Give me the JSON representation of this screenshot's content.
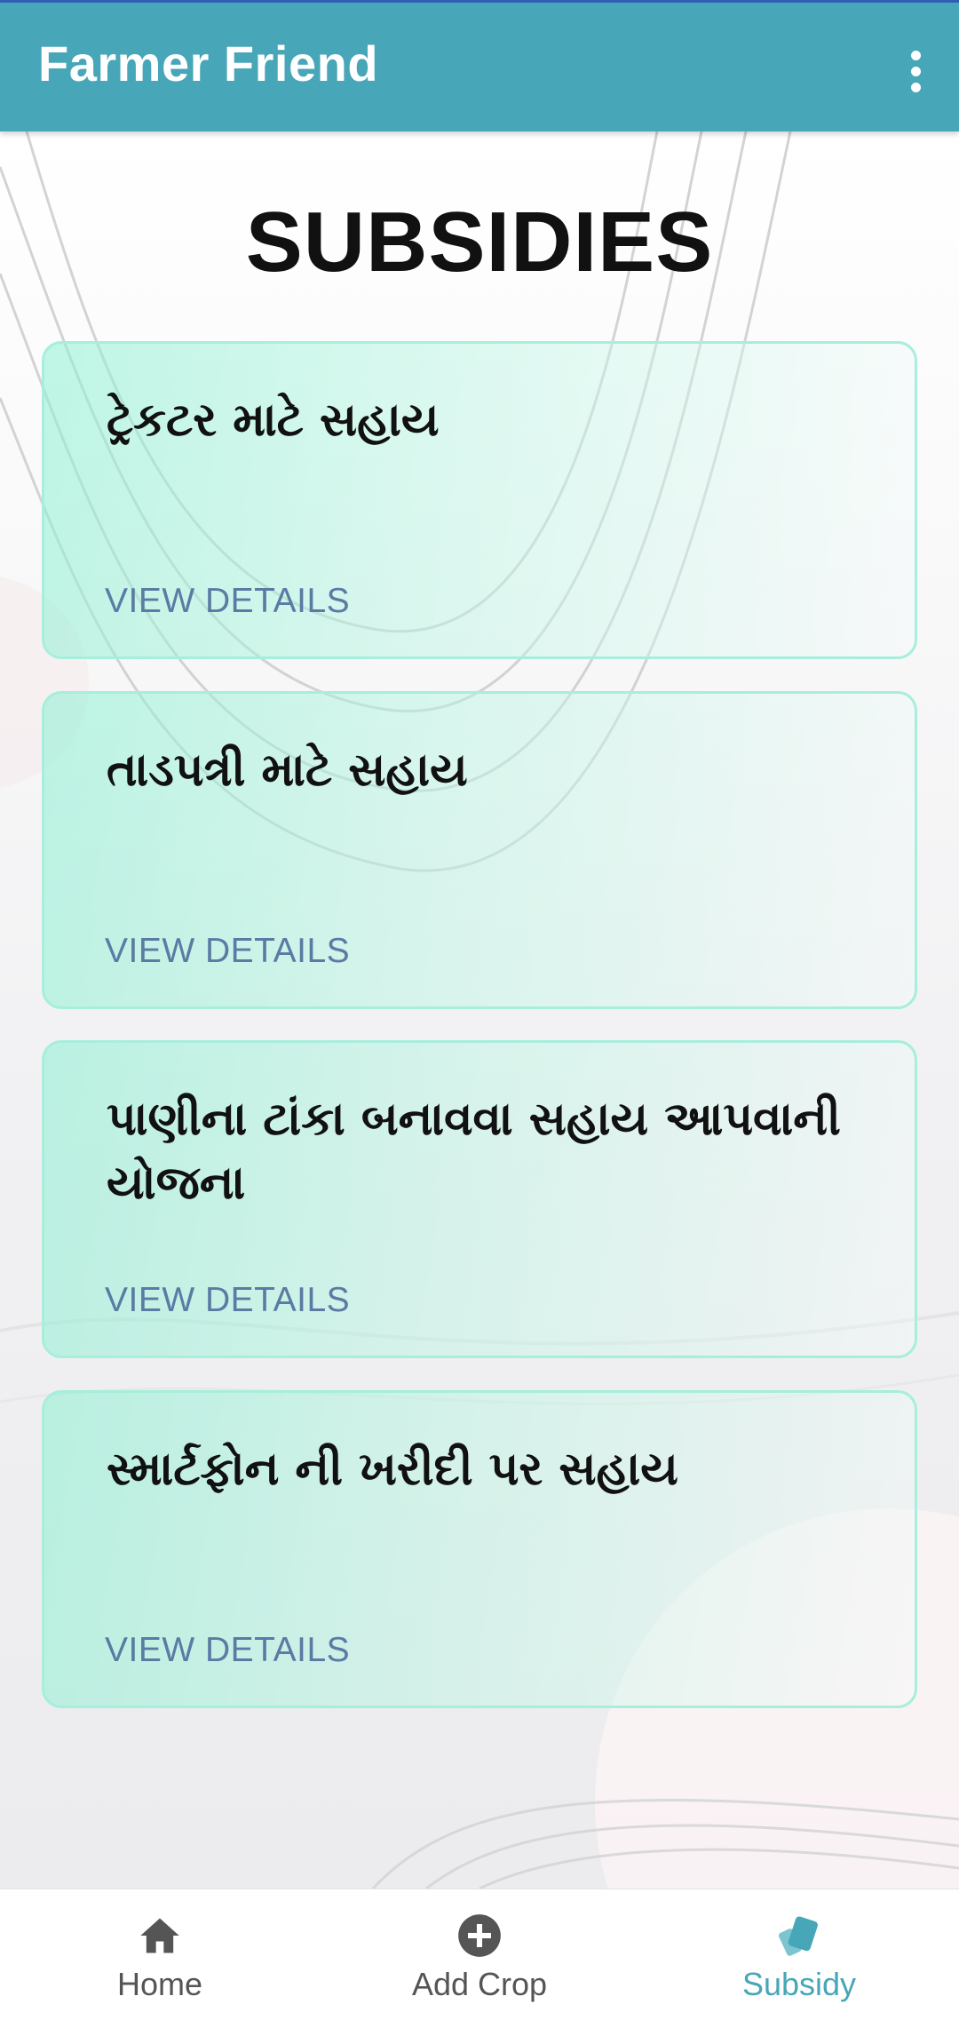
{
  "app_bar": {
    "title": "Farmer Friend",
    "menu_icon": "more-vertical-icon",
    "background_color": "#47a6b7"
  },
  "page": {
    "title": "SUBSIDIES"
  },
  "subsidies": [
    {
      "title": "ટ્રેકટર માટે સહાય",
      "action": "VIEW DETAILS"
    },
    {
      "title": "તાડપત્રી માટે સહાય",
      "action": "VIEW DETAILS"
    },
    {
      "title": "પાણીના ટાંકા બનાવવા સહાય આપવાની યોજના",
      "action": "VIEW DETAILS"
    },
    {
      "title": "સ્માર્ટફોન ની ખરીદી પર સહાય",
      "action": "VIEW DETAILS"
    }
  ],
  "bottom_nav": {
    "items": [
      {
        "label": "Home",
        "icon": "home-icon",
        "active": false
      },
      {
        "label": "Add Crop",
        "icon": "add-circle-icon",
        "active": false
      },
      {
        "label": "Subsidy",
        "icon": "cards-icon",
        "active": true
      }
    ],
    "active_color": "#47a6b7",
    "inactive_color": "#555555"
  }
}
